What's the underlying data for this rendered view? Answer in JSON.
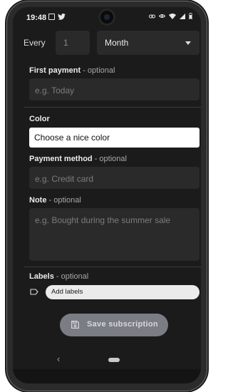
{
  "status_bar": {
    "time": "19:48",
    "left_icons": [
      "gallery-icon",
      "twitter-icon"
    ],
    "right_icons": [
      "link-icon",
      "eye-icon",
      "wifi-icon",
      "signal-icon",
      "battery-icon"
    ]
  },
  "recurrence": {
    "every_label": "Every",
    "count_placeholder": "1",
    "period_value": "Month"
  },
  "first_payment": {
    "label": "First payment",
    "optional": " - optional",
    "placeholder": "e.g. Today"
  },
  "color": {
    "label": "Color",
    "value": "Choose a nice color"
  },
  "payment_method": {
    "label": "Payment method",
    "optional": " - optional",
    "placeholder": "e.g. Credit card"
  },
  "note": {
    "label": "Note",
    "optional": " - optional",
    "placeholder": "e.g. Bought during the summer sale"
  },
  "labels": {
    "label": "Labels",
    "optional": " - optional",
    "chip_text": "Add labels"
  },
  "save_button": {
    "label": "Save subscription",
    "icon": "floppy-disk-icon"
  },
  "nav": {
    "back_glyph": "‹"
  },
  "colors": {
    "background": "#1b1b1b",
    "field": "#2a2a2a",
    "button": "#7a7d84"
  }
}
